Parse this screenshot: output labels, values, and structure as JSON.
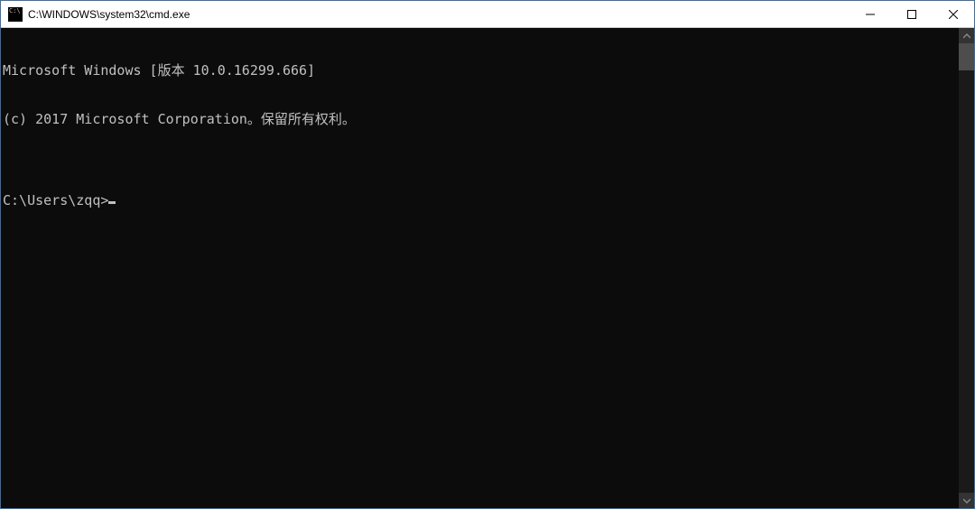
{
  "window": {
    "title": "C:\\WINDOWS\\system32\\cmd.exe"
  },
  "console": {
    "line1": "Microsoft Windows [版本 10.0.16299.666]",
    "line2": "(c) 2017 Microsoft Corporation。保留所有权利。",
    "blank": "",
    "prompt": "C:\\Users\\zqq>"
  }
}
